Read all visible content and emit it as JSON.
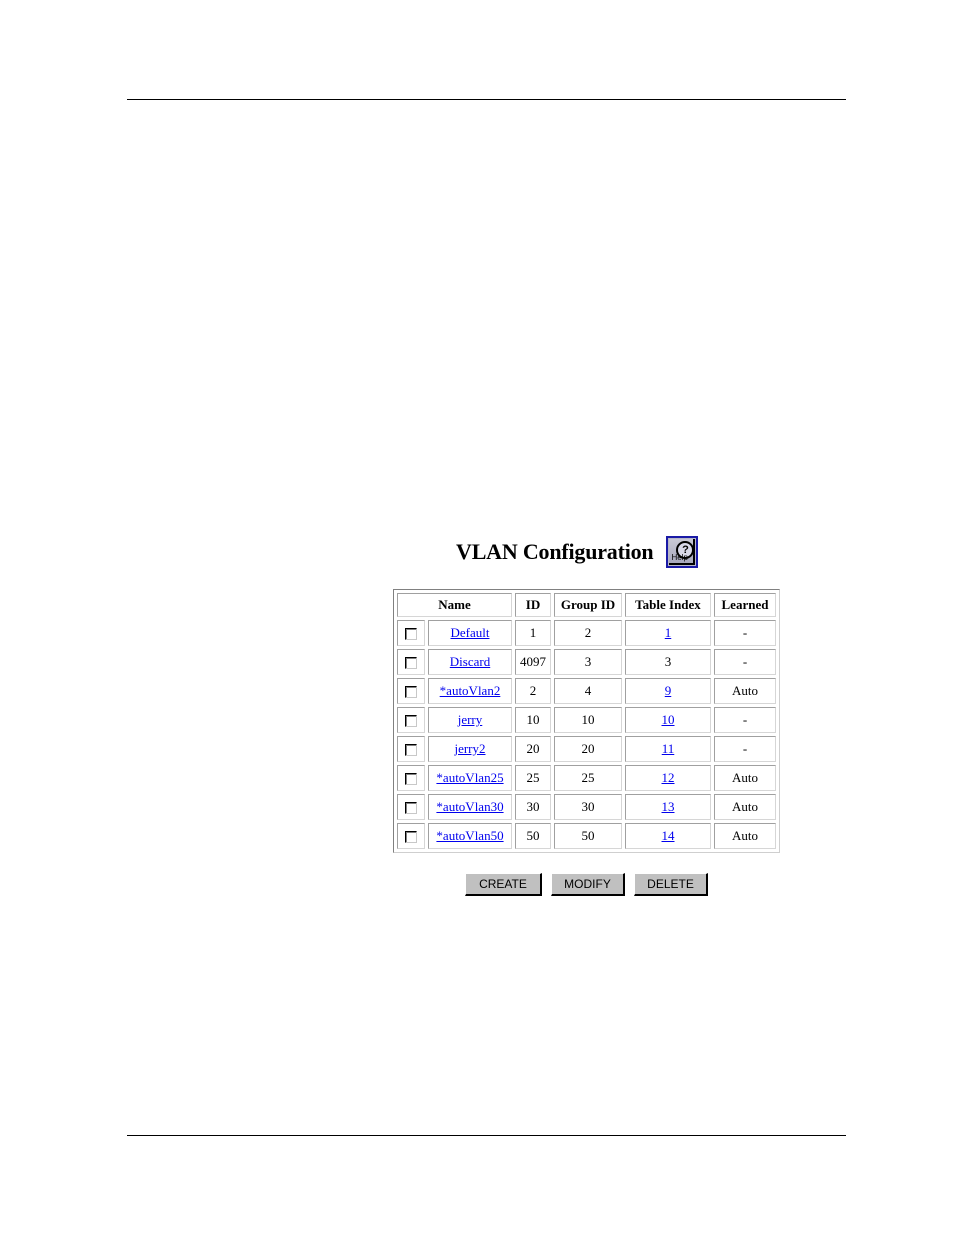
{
  "page": {
    "title": "VLAN Configuration",
    "help_label": "Help",
    "help_icon": "question-mark-icon"
  },
  "table": {
    "headers": [
      "Name",
      "ID",
      "Group ID",
      "Table Index",
      "Learned"
    ],
    "rows": [
      {
        "name": "Default",
        "id": "1",
        "group_id": "2",
        "table_index": "1",
        "table_index_link": true,
        "learned": "-"
      },
      {
        "name": "Discard",
        "id": "4097",
        "group_id": "3",
        "table_index": "3",
        "table_index_link": false,
        "learned": "-"
      },
      {
        "name": "*autoVlan2",
        "id": "2",
        "group_id": "4",
        "table_index": "9",
        "table_index_link": true,
        "learned": "Auto"
      },
      {
        "name": "jerry",
        "id": "10",
        "group_id": "10",
        "table_index": "10",
        "table_index_link": true,
        "learned": "-"
      },
      {
        "name": "jerry2",
        "id": "20",
        "group_id": "20",
        "table_index": "11",
        "table_index_link": true,
        "learned": "-"
      },
      {
        "name": "*autoVlan25",
        "id": "25",
        "group_id": "25",
        "table_index": "12",
        "table_index_link": true,
        "learned": "Auto"
      },
      {
        "name": "*autoVlan30",
        "id": "30",
        "group_id": "30",
        "table_index": "13",
        "table_index_link": true,
        "learned": "Auto"
      },
      {
        "name": "*autoVlan50",
        "id": "50",
        "group_id": "50",
        "table_index": "14",
        "table_index_link": true,
        "learned": "Auto"
      }
    ]
  },
  "buttons": {
    "create": "CREATE",
    "modify": "MODIFY",
    "delete": "DELETE"
  },
  "colors": {
    "link": "#0000ee",
    "button_face": "#c0c0c0"
  }
}
